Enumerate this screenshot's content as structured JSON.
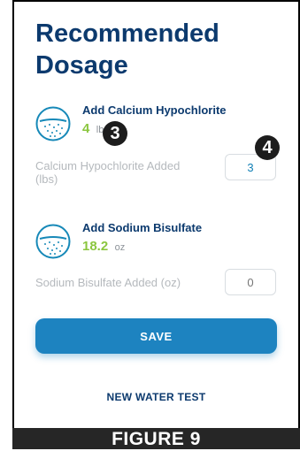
{
  "page": {
    "title": "Recommended Dosage"
  },
  "doses": {
    "calcium": {
      "name": "Add Calcium Hypochlorite",
      "value": "4",
      "unit": "lbs",
      "icon": "beaker-icon"
    },
    "sodium": {
      "name": "Add Sodium Bisulfate",
      "value": "18.2",
      "unit": "oz",
      "icon": "beaker-icon"
    }
  },
  "fields": {
    "calcium": {
      "label": "Calcium Hypochlorite Added",
      "unit": "(lbs)",
      "value": "3"
    },
    "sodium": {
      "label": "Sodium Bisulfate Added",
      "unit": "(oz)",
      "placeholder": "0"
    }
  },
  "callouts": {
    "first": "3",
    "second": "4"
  },
  "actions": {
    "save_label": "SAVE",
    "new_test_label": "NEW WATER TEST"
  },
  "caption": "FIGURE 9",
  "colors": {
    "navy": "#0c3a6e",
    "accent_green": "#8bc63f",
    "button_blue": "#1d83c0",
    "icon_teal": "#1789b8"
  }
}
